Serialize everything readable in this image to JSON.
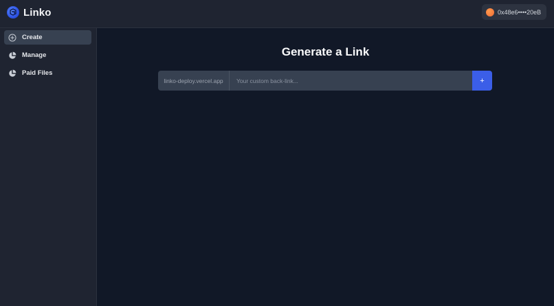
{
  "header": {
    "brand_name": "Linko",
    "brand_icon": "linko-logo-icon",
    "wallet_address": "0x48e6••••20eB"
  },
  "sidebar": {
    "items": [
      {
        "label": "Create",
        "icon": "plus-circle-icon",
        "active": true
      },
      {
        "label": "Manage",
        "icon": "pie-chart-icon",
        "active": false
      },
      {
        "label": "Paid Files",
        "icon": "pie-chart-icon",
        "active": false
      }
    ]
  },
  "main": {
    "title": "Generate a Link",
    "domain_prefix": "linko-deploy.vercel.app",
    "backlink_placeholder": "Your custom back-link...",
    "add_button_label": "+"
  },
  "colors": {
    "background": "#111827",
    "panel": "#1f2431",
    "accent": "#3b5ee8",
    "active_item": "#374151"
  }
}
